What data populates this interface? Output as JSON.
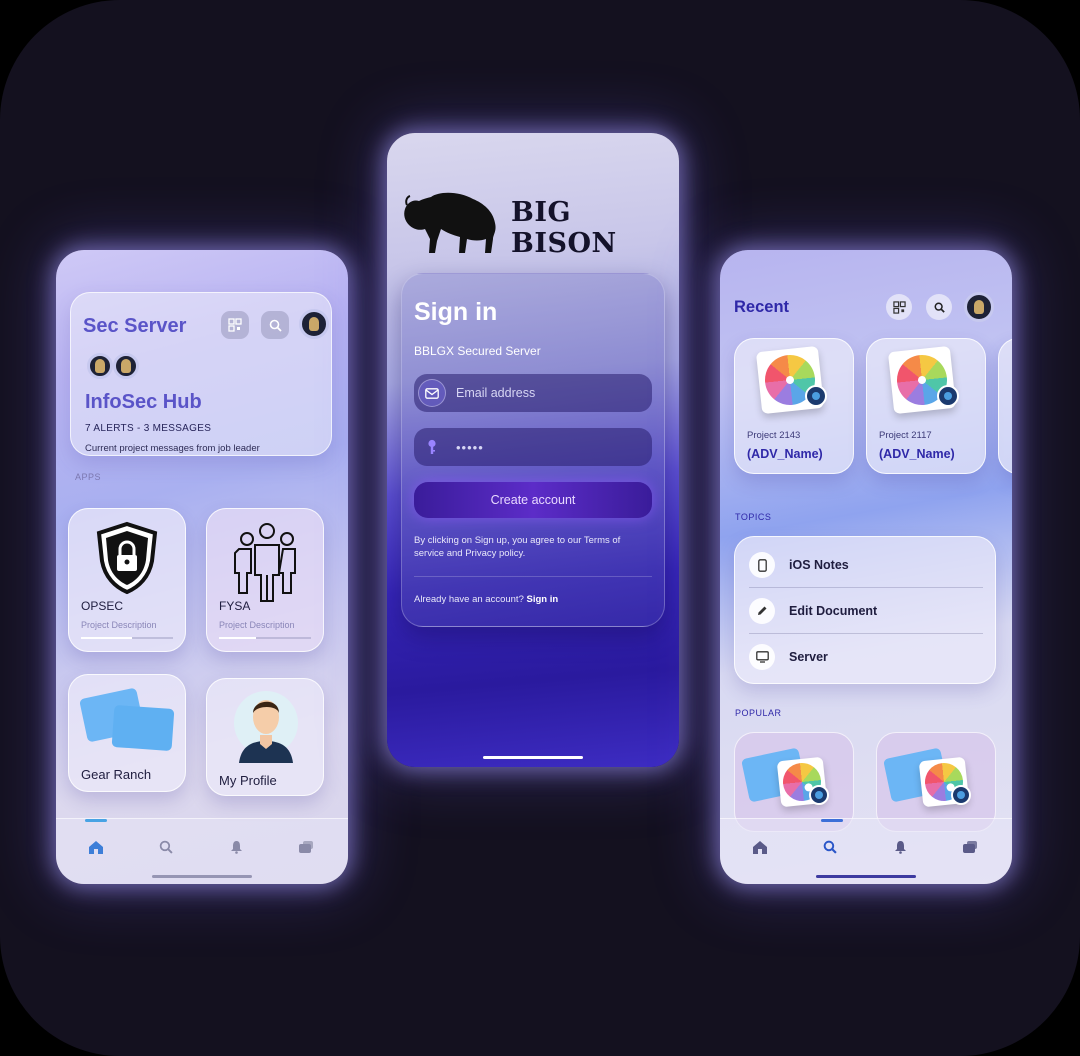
{
  "left_screen": {
    "header": {
      "title": "Sec Server",
      "hub_title": "InfoSec Hub",
      "alerts": "7 ALERTS - 3 MESSAGES",
      "message": "Current project messages from job leader"
    },
    "apps_label": "APPS",
    "apps": [
      {
        "name": "OPSEC",
        "description": "Project Description",
        "icon": "lock-shield-icon",
        "progress": 0.55
      },
      {
        "name": "FYSA",
        "description": "Project Description",
        "icon": "group-icon",
        "progress": 0.4
      },
      {
        "name": "Gear Ranch",
        "icon": "folder-icon"
      },
      {
        "name": "My Profile",
        "icon": "profile-avatar-icon"
      }
    ],
    "tabs": [
      {
        "icon": "home-icon",
        "active": true
      },
      {
        "icon": "search-icon",
        "active": false
      },
      {
        "icon": "bell-icon",
        "active": false
      },
      {
        "icon": "stack-icon",
        "active": false
      }
    ]
  },
  "middle_screen": {
    "brand": "BIG BISON",
    "signin_title": "Sign in",
    "server": "BBLGX Secured Server",
    "email_placeholder": "Email address",
    "password_value": "•••••",
    "create_button": "Create account",
    "terms": "By clicking on Sign up, you agree to our Terms of service and Privacy policy.",
    "have_account": "Already have an account?",
    "signin_link": "Sign in"
  },
  "right_screen": {
    "title": "Recent",
    "projects": [
      {
        "id": "Project 2143",
        "name": "(ADV_Name)"
      },
      {
        "id": "Project 2117",
        "name": "(ADV_Name)"
      }
    ],
    "topics_label": "TOPICS",
    "topics": [
      {
        "label": "iOS Notes",
        "icon": "phone-icon"
      },
      {
        "label": "Edit Document",
        "icon": "pencil-icon"
      },
      {
        "label": "Server",
        "icon": "monitor-icon"
      }
    ],
    "popular_label": "POPULAR",
    "tabs": [
      {
        "icon": "home-icon",
        "active": false
      },
      {
        "icon": "search-icon",
        "active": true
      },
      {
        "icon": "bell-icon",
        "active": false
      },
      {
        "icon": "stack-icon",
        "active": false
      }
    ]
  },
  "colors": {
    "background": "#14111f",
    "accent_purple": "#5a54c8",
    "accent_blue_text": "#2f28a8"
  }
}
